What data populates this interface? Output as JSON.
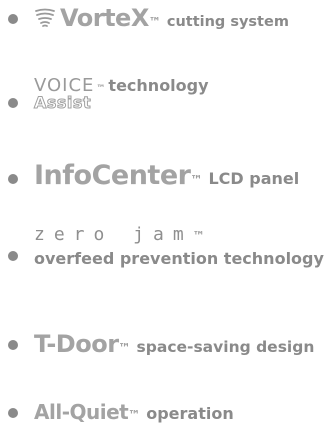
{
  "features": [
    {
      "brand": "VorteX",
      "mark": "™",
      "desc": "cutting system",
      "icon": "vortex-swirl-icon"
    },
    {
      "brand_top": "VOICE",
      "brand_bottom": "Assist",
      "mark": "™",
      "desc": "technology"
    },
    {
      "brand": "InfoCenter",
      "mark": "™",
      "desc": "LCD panel"
    },
    {
      "brand": "zero jam",
      "mark": "™",
      "desc": "overfeed prevention technology"
    },
    {
      "brand": "T-Door",
      "mark": "™",
      "desc": "space-saving design"
    },
    {
      "brand": "All-Quiet",
      "mark": "™",
      "desc": "operation"
    }
  ],
  "colors": {
    "text": "#8a8a8a",
    "brand": "#a3a3a3",
    "background": "#ffffff"
  }
}
